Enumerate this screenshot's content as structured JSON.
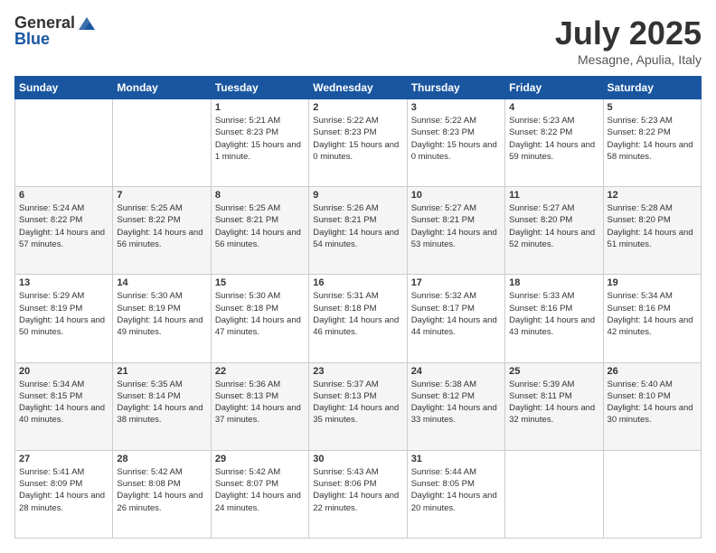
{
  "logo": {
    "line1": "General",
    "line2": "Blue"
  },
  "title": "July 2025",
  "location": "Mesagne, Apulia, Italy",
  "weekdays": [
    "Sunday",
    "Monday",
    "Tuesday",
    "Wednesday",
    "Thursday",
    "Friday",
    "Saturday"
  ],
  "weeks": [
    [
      {
        "day": null
      },
      {
        "day": null
      },
      {
        "day": "1",
        "sunrise": "5:21 AM",
        "sunset": "8:23 PM",
        "daylight": "15 hours and 1 minute."
      },
      {
        "day": "2",
        "sunrise": "5:22 AM",
        "sunset": "8:23 PM",
        "daylight": "15 hours and 0 minutes."
      },
      {
        "day": "3",
        "sunrise": "5:22 AM",
        "sunset": "8:23 PM",
        "daylight": "15 hours and 0 minutes."
      },
      {
        "day": "4",
        "sunrise": "5:23 AM",
        "sunset": "8:22 PM",
        "daylight": "14 hours and 59 minutes."
      },
      {
        "day": "5",
        "sunrise": "5:23 AM",
        "sunset": "8:22 PM",
        "daylight": "14 hours and 58 minutes."
      }
    ],
    [
      {
        "day": "6",
        "sunrise": "5:24 AM",
        "sunset": "8:22 PM",
        "daylight": "14 hours and 57 minutes."
      },
      {
        "day": "7",
        "sunrise": "5:25 AM",
        "sunset": "8:22 PM",
        "daylight": "14 hours and 56 minutes."
      },
      {
        "day": "8",
        "sunrise": "5:25 AM",
        "sunset": "8:21 PM",
        "daylight": "14 hours and 56 minutes."
      },
      {
        "day": "9",
        "sunrise": "5:26 AM",
        "sunset": "8:21 PM",
        "daylight": "14 hours and 54 minutes."
      },
      {
        "day": "10",
        "sunrise": "5:27 AM",
        "sunset": "8:21 PM",
        "daylight": "14 hours and 53 minutes."
      },
      {
        "day": "11",
        "sunrise": "5:27 AM",
        "sunset": "8:20 PM",
        "daylight": "14 hours and 52 minutes."
      },
      {
        "day": "12",
        "sunrise": "5:28 AM",
        "sunset": "8:20 PM",
        "daylight": "14 hours and 51 minutes."
      }
    ],
    [
      {
        "day": "13",
        "sunrise": "5:29 AM",
        "sunset": "8:19 PM",
        "daylight": "14 hours and 50 minutes."
      },
      {
        "day": "14",
        "sunrise": "5:30 AM",
        "sunset": "8:19 PM",
        "daylight": "14 hours and 49 minutes."
      },
      {
        "day": "15",
        "sunrise": "5:30 AM",
        "sunset": "8:18 PM",
        "daylight": "14 hours and 47 minutes."
      },
      {
        "day": "16",
        "sunrise": "5:31 AM",
        "sunset": "8:18 PM",
        "daylight": "14 hours and 46 minutes."
      },
      {
        "day": "17",
        "sunrise": "5:32 AM",
        "sunset": "8:17 PM",
        "daylight": "14 hours and 44 minutes."
      },
      {
        "day": "18",
        "sunrise": "5:33 AM",
        "sunset": "8:16 PM",
        "daylight": "14 hours and 43 minutes."
      },
      {
        "day": "19",
        "sunrise": "5:34 AM",
        "sunset": "8:16 PM",
        "daylight": "14 hours and 42 minutes."
      }
    ],
    [
      {
        "day": "20",
        "sunrise": "5:34 AM",
        "sunset": "8:15 PM",
        "daylight": "14 hours and 40 minutes."
      },
      {
        "day": "21",
        "sunrise": "5:35 AM",
        "sunset": "8:14 PM",
        "daylight": "14 hours and 38 minutes."
      },
      {
        "day": "22",
        "sunrise": "5:36 AM",
        "sunset": "8:13 PM",
        "daylight": "14 hours and 37 minutes."
      },
      {
        "day": "23",
        "sunrise": "5:37 AM",
        "sunset": "8:13 PM",
        "daylight": "14 hours and 35 minutes."
      },
      {
        "day": "24",
        "sunrise": "5:38 AM",
        "sunset": "8:12 PM",
        "daylight": "14 hours and 33 minutes."
      },
      {
        "day": "25",
        "sunrise": "5:39 AM",
        "sunset": "8:11 PM",
        "daylight": "14 hours and 32 minutes."
      },
      {
        "day": "26",
        "sunrise": "5:40 AM",
        "sunset": "8:10 PM",
        "daylight": "14 hours and 30 minutes."
      }
    ],
    [
      {
        "day": "27",
        "sunrise": "5:41 AM",
        "sunset": "8:09 PM",
        "daylight": "14 hours and 28 minutes."
      },
      {
        "day": "28",
        "sunrise": "5:42 AM",
        "sunset": "8:08 PM",
        "daylight": "14 hours and 26 minutes."
      },
      {
        "day": "29",
        "sunrise": "5:42 AM",
        "sunset": "8:07 PM",
        "daylight": "14 hours and 24 minutes."
      },
      {
        "day": "30",
        "sunrise": "5:43 AM",
        "sunset": "8:06 PM",
        "daylight": "14 hours and 22 minutes."
      },
      {
        "day": "31",
        "sunrise": "5:44 AM",
        "sunset": "8:05 PM",
        "daylight": "14 hours and 20 minutes."
      },
      {
        "day": null
      },
      {
        "day": null
      }
    ]
  ]
}
